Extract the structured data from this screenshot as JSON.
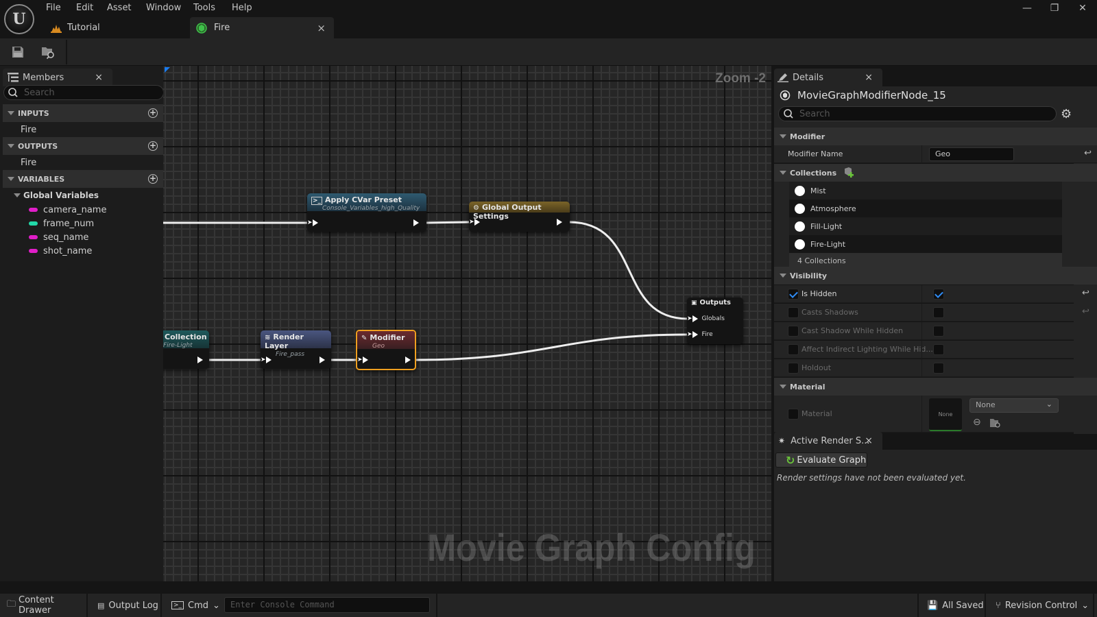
{
  "menu": [
    "File",
    "Edit",
    "Asset",
    "Window",
    "Tools",
    "Help"
  ],
  "tabs": [
    {
      "label": "Tutorial",
      "icon": "level-icon",
      "active": false
    },
    {
      "label": "Fire",
      "icon": "movie-graph-icon",
      "active": true,
      "close": "×"
    }
  ],
  "window_controls": {
    "minimize": "—",
    "restore": "❐",
    "close": "✕"
  },
  "members": {
    "title": "Members",
    "close": "×",
    "search_placeholder": "Search",
    "sections": [
      {
        "label": "INPUTS",
        "items": [
          "Fire"
        ]
      },
      {
        "label": "OUTPUTS",
        "items": [
          "Fire"
        ]
      },
      {
        "label": "VARIABLES",
        "group": "Global Variables",
        "variables": [
          {
            "name": "camera_name",
            "color": "#e01ec8"
          },
          {
            "name": "frame_num",
            "color": "#22d8a8"
          },
          {
            "name": "seq_name",
            "color": "#e01ec8"
          },
          {
            "name": "shot_name",
            "color": "#e01ec8"
          }
        ]
      }
    ]
  },
  "graph": {
    "zoom_label": "Zoom -2",
    "watermark": "Movie Graph Config",
    "nodes": {
      "collection": {
        "title": "Collection",
        "subtitle": "Fire-Light",
        "color": "#1f5a5c"
      },
      "render_layer": {
        "title": "Render Layer",
        "subtitle": "Fire_pass",
        "color": "#4a5680"
      },
      "modifier": {
        "title": "Modifier",
        "subtitle": "Geo",
        "color": "#6a2a2e",
        "selected_color": "#f0a020"
      },
      "cvar": {
        "title": "Apply CVar Preset",
        "subtitle": "Console_Variables_high_Quality",
        "color": "#2f5a70"
      },
      "global_output": {
        "title": "Global Output Settings",
        "color": "#7a6428"
      },
      "outputs": {
        "title": "Outputs",
        "pins": [
          "Globals",
          "Fire"
        ]
      }
    }
  },
  "details": {
    "title": "Details",
    "close": "×",
    "object_name": "MovieGraphModifierNode_15",
    "search_placeholder": "Search",
    "modifier": {
      "category": "Modifier",
      "name_label": "Modifier Name",
      "name_value": "Geo"
    },
    "collections": {
      "category": "Collections",
      "items": [
        "Mist",
        "Atmosphere",
        "Fill-Light",
        "Fire-Light"
      ],
      "summary": "4 Collections"
    },
    "visibility": {
      "category": "Visibility",
      "rows": [
        {
          "label": "Is Hidden",
          "override": true,
          "value": true,
          "reset": true
        },
        {
          "label": "Casts Shadows",
          "override": false,
          "value": false,
          "reset": true
        },
        {
          "label": "Cast Shadow While Hidden",
          "override": false,
          "value": false,
          "reset": false
        },
        {
          "label": "Affect Indirect Lighting While Hid...",
          "override": false,
          "value": false,
          "reset": false
        },
        {
          "label": "Holdout",
          "override": false,
          "value": false,
          "reset": false
        }
      ]
    },
    "material": {
      "category": "Material",
      "label": "Material",
      "thumb_label": "None",
      "dropdown_value": "None"
    }
  },
  "render_settings": {
    "title": "Active Render S...",
    "close": "×",
    "evaluate_label": "Evaluate Graph",
    "message": "Render settings have not been evaluated yet."
  },
  "statusbar": {
    "content_drawer": "Content Drawer",
    "output_log": "Output Log",
    "cmd": "Cmd",
    "console_placeholder": "Enter Console Command",
    "saved": "All Saved",
    "revision": "Revision Control"
  }
}
